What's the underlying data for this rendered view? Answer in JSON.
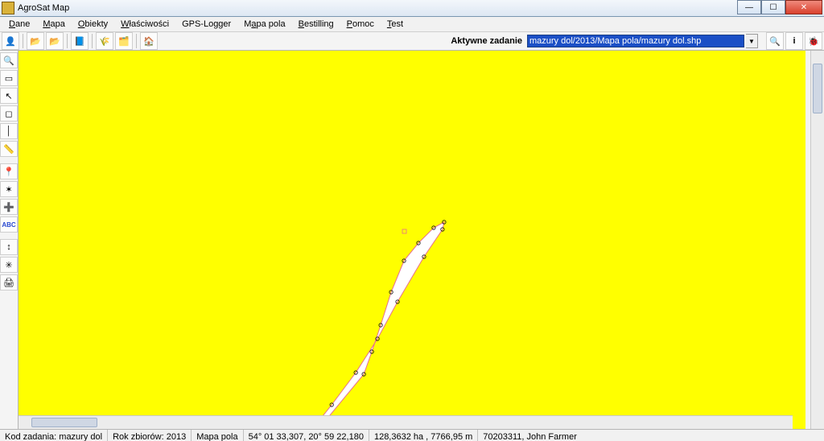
{
  "title": "AgroSat Map",
  "menus": {
    "dane": "Dane",
    "mapa": "Mapa",
    "obiekty": "Obiekty",
    "wlasciwosci": "Właściwości",
    "gps_logger": "GPS-Logger",
    "mapa_pola": "Mapa pola",
    "bestilling": "Bestilling",
    "pomoc": "Pomoc",
    "test": "Test"
  },
  "toolbar": {
    "active_task_label": "Aktywne zadanie",
    "active_task_value": "mazury dol/2013/Mapa pola/mazury dol.shp"
  },
  "status": {
    "kod_label": "Kod zadania:",
    "kod_value": "mazury dol",
    "rok_label": "Rok zbiorów:",
    "rok_value": "2013",
    "mapa": "Mapa pola",
    "coords": "54° 01 33,307, 20° 59 22,180",
    "area": "128,3632 ha , 7766,95 m",
    "user": "70203311, John Farmer"
  },
  "colors": {
    "canvas_bg": "#FFFF00",
    "polygon_stroke": "#e76f8c",
    "polygon_fill": "#ffffff"
  }
}
